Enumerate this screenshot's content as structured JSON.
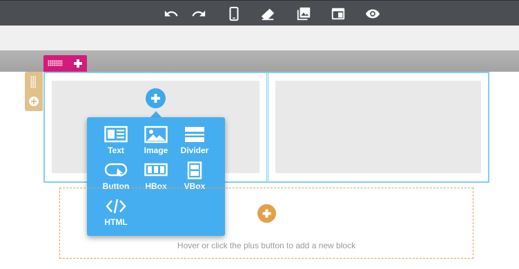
{
  "toolbar": {
    "buttons": [
      {
        "icon": "undo-icon"
      },
      {
        "icon": "redo-icon"
      },
      {
        "icon": "mobile-view-icon"
      },
      {
        "icon": "eraser-icon"
      },
      {
        "icon": "image-library-icon"
      },
      {
        "icon": "layout-window-icon"
      },
      {
        "icon": "preview-eye-icon"
      }
    ]
  },
  "popup": {
    "items": [
      {
        "label": "Text",
        "icon": "text-block-icon"
      },
      {
        "label": "Image",
        "icon": "image-block-icon"
      },
      {
        "label": "Divider",
        "icon": "divider-block-icon"
      },
      {
        "label": "Button",
        "icon": "button-block-icon"
      },
      {
        "label": "HBox",
        "icon": "hbox-block-icon"
      },
      {
        "label": "VBox",
        "icon": "vbox-block-icon"
      },
      {
        "label": "HTML",
        "icon": "html-block-icon"
      }
    ]
  },
  "drop_zone": {
    "hint": "Hover or click the plus button to add a new block"
  },
  "colors": {
    "toolbar": "#4b4e53",
    "row_handle": "#d31b7a",
    "side_handle": "#e2c08a",
    "row_border": "#7fcff0",
    "popup": "#45aef0",
    "add_orange": "#e2a04a"
  }
}
